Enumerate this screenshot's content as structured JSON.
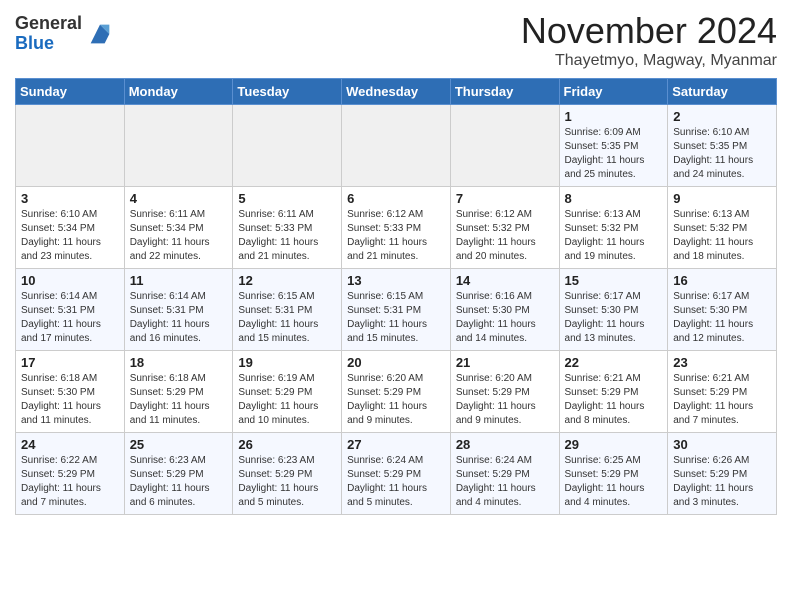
{
  "logo": {
    "general": "General",
    "blue": "Blue"
  },
  "title": "November 2024",
  "subtitle": "Thayetmyo, Magway, Myanmar",
  "days": [
    "Sunday",
    "Monday",
    "Tuesday",
    "Wednesday",
    "Thursday",
    "Friday",
    "Saturday"
  ],
  "weeks": [
    [
      {
        "num": "",
        "text": ""
      },
      {
        "num": "",
        "text": ""
      },
      {
        "num": "",
        "text": ""
      },
      {
        "num": "",
        "text": ""
      },
      {
        "num": "",
        "text": ""
      },
      {
        "num": "1",
        "text": "Sunrise: 6:09 AM\nSunset: 5:35 PM\nDaylight: 11 hours and 25 minutes."
      },
      {
        "num": "2",
        "text": "Sunrise: 6:10 AM\nSunset: 5:35 PM\nDaylight: 11 hours and 24 minutes."
      }
    ],
    [
      {
        "num": "3",
        "text": "Sunrise: 6:10 AM\nSunset: 5:34 PM\nDaylight: 11 hours and 23 minutes."
      },
      {
        "num": "4",
        "text": "Sunrise: 6:11 AM\nSunset: 5:34 PM\nDaylight: 11 hours and 22 minutes."
      },
      {
        "num": "5",
        "text": "Sunrise: 6:11 AM\nSunset: 5:33 PM\nDaylight: 11 hours and 21 minutes."
      },
      {
        "num": "6",
        "text": "Sunrise: 6:12 AM\nSunset: 5:33 PM\nDaylight: 11 hours and 21 minutes."
      },
      {
        "num": "7",
        "text": "Sunrise: 6:12 AM\nSunset: 5:32 PM\nDaylight: 11 hours and 20 minutes."
      },
      {
        "num": "8",
        "text": "Sunrise: 6:13 AM\nSunset: 5:32 PM\nDaylight: 11 hours and 19 minutes."
      },
      {
        "num": "9",
        "text": "Sunrise: 6:13 AM\nSunset: 5:32 PM\nDaylight: 11 hours and 18 minutes."
      }
    ],
    [
      {
        "num": "10",
        "text": "Sunrise: 6:14 AM\nSunset: 5:31 PM\nDaylight: 11 hours and 17 minutes."
      },
      {
        "num": "11",
        "text": "Sunrise: 6:14 AM\nSunset: 5:31 PM\nDaylight: 11 hours and 16 minutes."
      },
      {
        "num": "12",
        "text": "Sunrise: 6:15 AM\nSunset: 5:31 PM\nDaylight: 11 hours and 15 minutes."
      },
      {
        "num": "13",
        "text": "Sunrise: 6:15 AM\nSunset: 5:31 PM\nDaylight: 11 hours and 15 minutes."
      },
      {
        "num": "14",
        "text": "Sunrise: 6:16 AM\nSunset: 5:30 PM\nDaylight: 11 hours and 14 minutes."
      },
      {
        "num": "15",
        "text": "Sunrise: 6:17 AM\nSunset: 5:30 PM\nDaylight: 11 hours and 13 minutes."
      },
      {
        "num": "16",
        "text": "Sunrise: 6:17 AM\nSunset: 5:30 PM\nDaylight: 11 hours and 12 minutes."
      }
    ],
    [
      {
        "num": "17",
        "text": "Sunrise: 6:18 AM\nSunset: 5:30 PM\nDaylight: 11 hours and 11 minutes."
      },
      {
        "num": "18",
        "text": "Sunrise: 6:18 AM\nSunset: 5:29 PM\nDaylight: 11 hours and 11 minutes."
      },
      {
        "num": "19",
        "text": "Sunrise: 6:19 AM\nSunset: 5:29 PM\nDaylight: 11 hours and 10 minutes."
      },
      {
        "num": "20",
        "text": "Sunrise: 6:20 AM\nSunset: 5:29 PM\nDaylight: 11 hours and 9 minutes."
      },
      {
        "num": "21",
        "text": "Sunrise: 6:20 AM\nSunset: 5:29 PM\nDaylight: 11 hours and 9 minutes."
      },
      {
        "num": "22",
        "text": "Sunrise: 6:21 AM\nSunset: 5:29 PM\nDaylight: 11 hours and 8 minutes."
      },
      {
        "num": "23",
        "text": "Sunrise: 6:21 AM\nSunset: 5:29 PM\nDaylight: 11 hours and 7 minutes."
      }
    ],
    [
      {
        "num": "24",
        "text": "Sunrise: 6:22 AM\nSunset: 5:29 PM\nDaylight: 11 hours and 7 minutes."
      },
      {
        "num": "25",
        "text": "Sunrise: 6:23 AM\nSunset: 5:29 PM\nDaylight: 11 hours and 6 minutes."
      },
      {
        "num": "26",
        "text": "Sunrise: 6:23 AM\nSunset: 5:29 PM\nDaylight: 11 hours and 5 minutes."
      },
      {
        "num": "27",
        "text": "Sunrise: 6:24 AM\nSunset: 5:29 PM\nDaylight: 11 hours and 5 minutes."
      },
      {
        "num": "28",
        "text": "Sunrise: 6:24 AM\nSunset: 5:29 PM\nDaylight: 11 hours and 4 minutes."
      },
      {
        "num": "29",
        "text": "Sunrise: 6:25 AM\nSunset: 5:29 PM\nDaylight: 11 hours and 4 minutes."
      },
      {
        "num": "30",
        "text": "Sunrise: 6:26 AM\nSunset: 5:29 PM\nDaylight: 11 hours and 3 minutes."
      }
    ]
  ]
}
